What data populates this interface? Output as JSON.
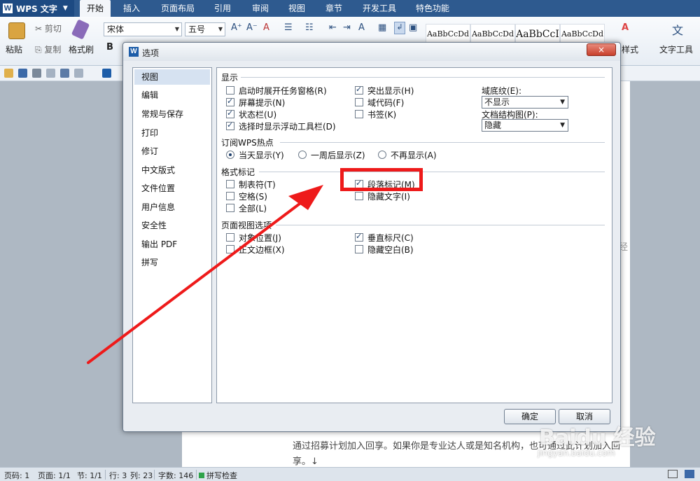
{
  "app": {
    "name": "WPS 文字"
  },
  "tabs": [
    "开始",
    "插入",
    "页面布局",
    "引用",
    "审阅",
    "视图",
    "章节",
    "开发工具",
    "特色功能"
  ],
  "ribbon": {
    "paste": "粘贴",
    "cut": "剪切",
    "copy": "复制",
    "format_painter": "格式刷",
    "bold": "B",
    "font": "宋体",
    "size": "五号",
    "styles": [
      "AaBbCcDd",
      "AaBbCcDd",
      "AaBbCcI",
      "AaBbCcDd"
    ],
    "style_btn": "样式",
    "text_tools": "文字工具"
  },
  "dialog": {
    "title": "选项",
    "close": "×",
    "nav": [
      "视图",
      "编辑",
      "常规与保存",
      "打印",
      "修订",
      "中文版式",
      "文件位置",
      "用户信息",
      "安全性",
      "输出 PDF",
      "拼写"
    ],
    "sections": {
      "display": "显示",
      "hotspot": "订阅WPS热点",
      "format_marks": "格式标记",
      "page_view": "页面视图选项"
    },
    "display_options": [
      {
        "label": "启动时展开任务窗格(R)",
        "checked": false
      },
      {
        "label": "屏幕提示(N)",
        "checked": true
      },
      {
        "label": "状态栏(U)",
        "checked": true
      },
      {
        "label": "选择时显示浮动工具栏(D)",
        "checked": true
      },
      {
        "label": "突出显示(H)",
        "checked": true
      },
      {
        "label": "域代码(F)",
        "checked": false
      },
      {
        "label": "书签(K)",
        "checked": false
      }
    ],
    "field_shading": {
      "label": "域底纹(E):",
      "value": "不显示"
    },
    "doc_map": {
      "label": "文档结构图(P):",
      "value": "隐藏"
    },
    "hotspot_options": [
      {
        "label": "当天显示(Y)",
        "checked": true
      },
      {
        "label": "一周后显示(Z)",
        "checked": false
      },
      {
        "label": "不再显示(A)",
        "checked": false
      }
    ],
    "format_options": [
      {
        "label": "制表符(T)",
        "checked": false
      },
      {
        "label": "空格(S)",
        "checked": false
      },
      {
        "label": "全部(L)",
        "checked": false
      },
      {
        "label": "段落标记(M)",
        "checked": true
      },
      {
        "label": "隐藏文字(I)",
        "checked": false
      }
    ],
    "page_view_options": [
      {
        "label": "对象位置(J)",
        "checked": false
      },
      {
        "label": "正文边框(X)",
        "checked": false
      },
      {
        "label": "垂直标尺(C)",
        "checked": true
      },
      {
        "label": "隐藏空白(B)",
        "checked": false
      }
    ],
    "ok": "确定",
    "cancel": "取消"
  },
  "document": {
    "line1": "通过招募计划加入回享。如果你是专业达人或是知名机构，也可通过此计划加入回",
    "line2": "享。↓",
    "edge_char": "经"
  },
  "status": {
    "page_no": "页码: 1",
    "pages": "页面: 1/1",
    "section": "节: 1/1",
    "row": "行: 3",
    "col": "列: 23",
    "words": "字数: 146",
    "spell": "拼写检查"
  },
  "watermark": {
    "big": "Baidu 经验",
    "small": "jingyan.baidu.com"
  },
  "colors": {
    "accent": "#2e5a8f",
    "highlight": "#ee1a1a"
  }
}
